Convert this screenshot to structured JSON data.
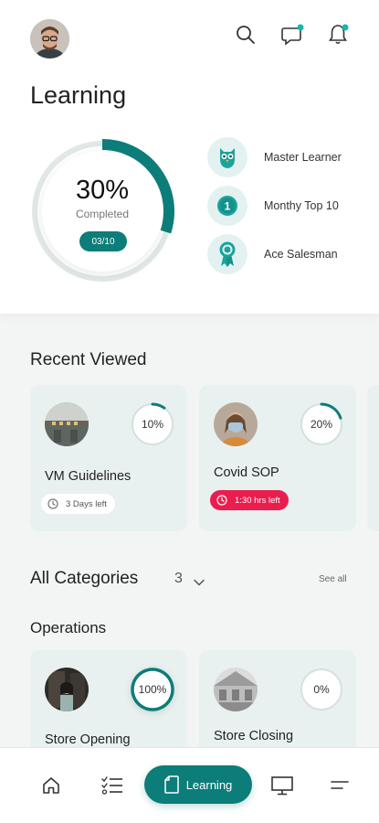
{
  "colors": {
    "accent": "#0c7d79",
    "accent_light": "#e3f2f1",
    "card_bg": "#e8f1f0",
    "urgent": "#ea1d4e",
    "notification_dot": "#19b5ad"
  },
  "header": {
    "avatar_icon": "user-avatar",
    "icons": [
      "search-icon",
      "chat-icon",
      "bell-icon"
    ]
  },
  "page_title": "Learning",
  "progress": {
    "percent_label": "30%",
    "fraction": 0.3,
    "completed_label": "Completed",
    "count_label": "03/10"
  },
  "badges": [
    {
      "label": "Master Learner",
      "icon": "owl-icon"
    },
    {
      "label": "Monthy Top 10",
      "icon": "rank-medal-icon",
      "number": "1"
    },
    {
      "label": "Ace Salesman",
      "icon": "award-ribbon-icon"
    }
  ],
  "recent": {
    "title": "Recent Viewed",
    "cards": [
      {
        "title": "VM Guidelines",
        "percent_label": "10%",
        "fraction": 0.1,
        "tag": "3 Days left",
        "tag_style": "neutral"
      },
      {
        "title": "Covid SOP",
        "percent_label": "20%",
        "fraction": 0.2,
        "tag": "1:30 hrs left",
        "tag_style": "urgent"
      }
    ]
  },
  "categories": {
    "title": "All Categories",
    "count": "3",
    "see_all": "See all",
    "group_title": "Operations",
    "cards": [
      {
        "title": "Store Opening",
        "percent_label": "100%",
        "fraction": 1.0
      },
      {
        "title": "Store Closing",
        "percent_label": "0%",
        "fraction": 0.0
      }
    ]
  },
  "nav": {
    "active_label": "Learning",
    "items": [
      "home-icon",
      "checklist-icon",
      "learning-icon",
      "presentation-icon",
      "menu-icon"
    ]
  }
}
